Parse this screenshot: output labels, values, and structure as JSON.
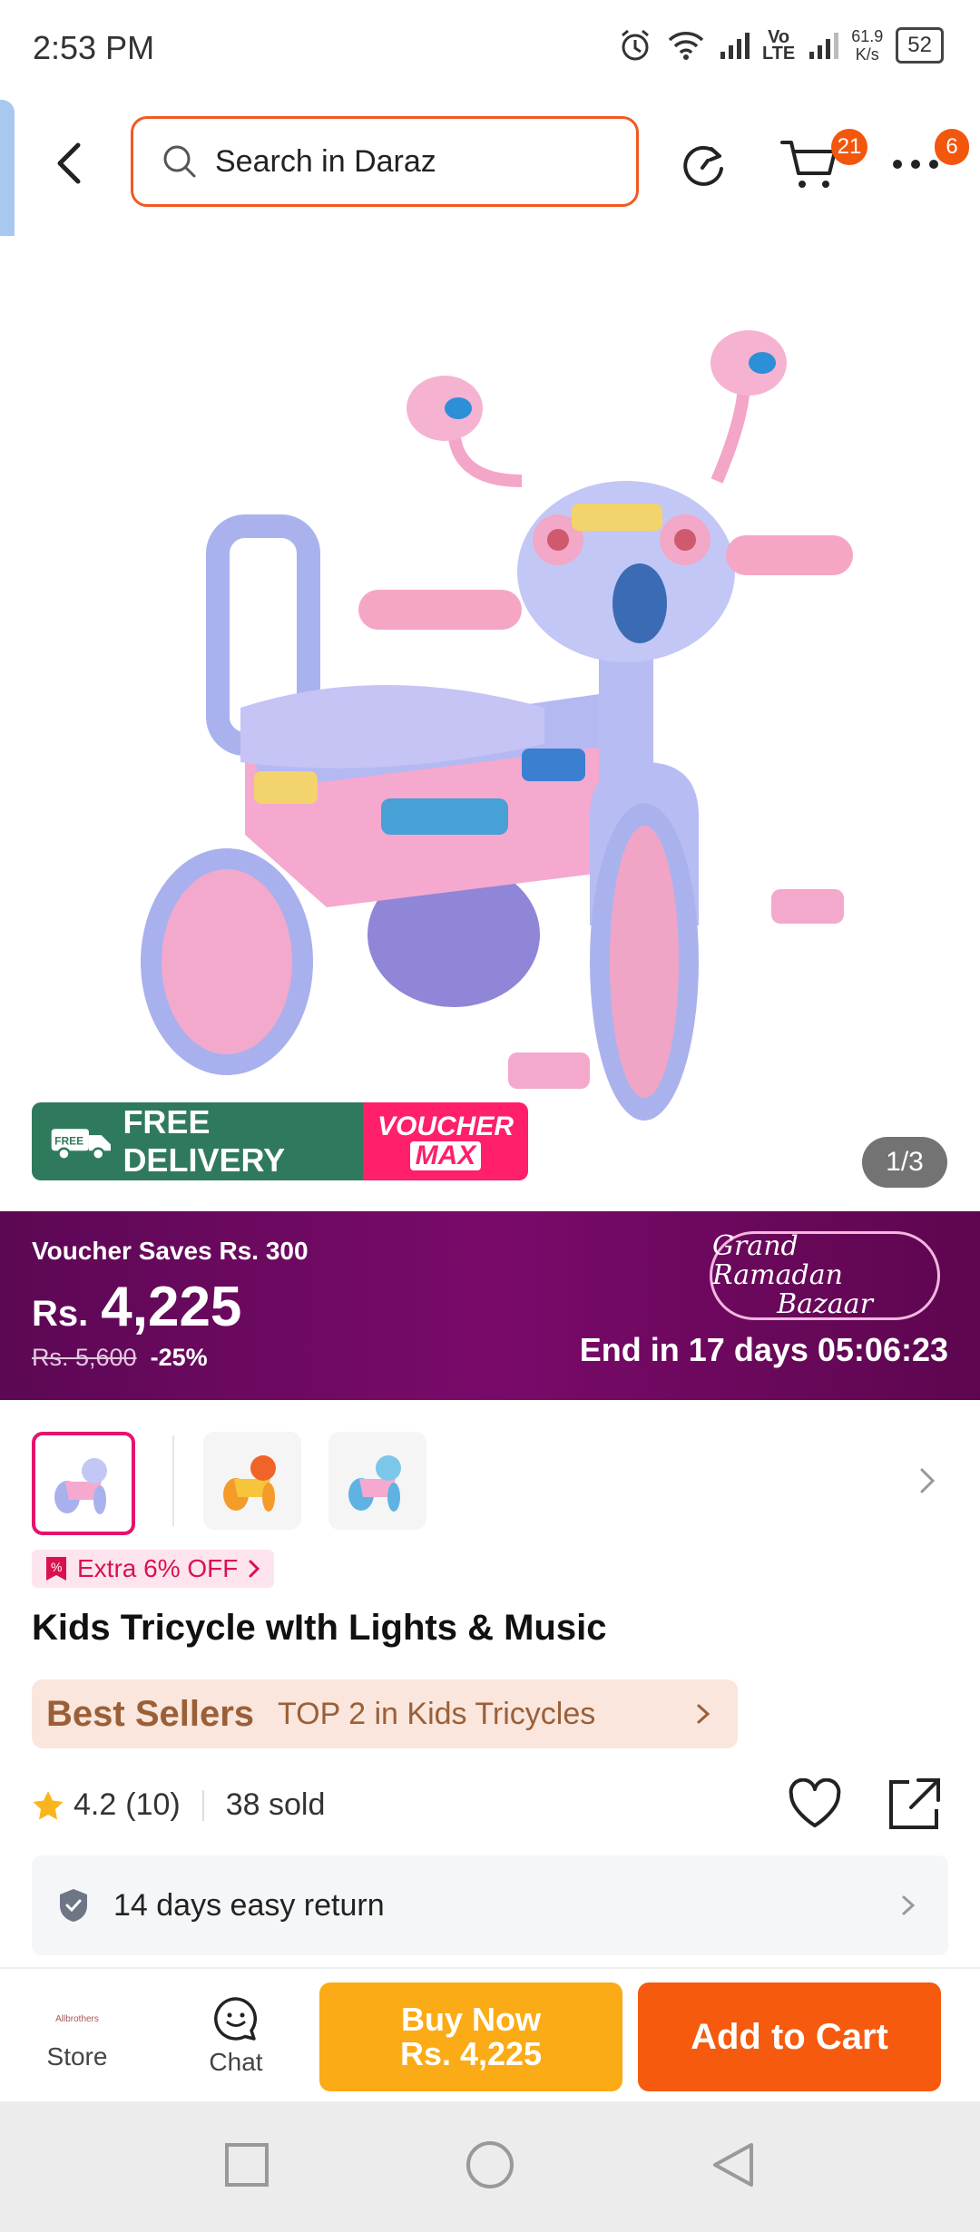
{
  "status_bar": {
    "time": "2:53 PM",
    "net_speed": "61.9",
    "net_unit": "K/s",
    "battery": "52",
    "volte": "Vo",
    "volte2": "LTE"
  },
  "header": {
    "search_placeholder": "Search in Daraz",
    "cart_count": "21",
    "more_count": "6"
  },
  "gallery": {
    "delivery_label": "FREE DELIVERY",
    "free_tag": "FREE",
    "voucher_line1": "VOUCHER",
    "voucher_line2": "MAX",
    "counter": "1/3"
  },
  "promo": {
    "voucher_saves": "Voucher Saves Rs. 300",
    "currency": "Rs.",
    "price": "4,225",
    "old_price": "Rs. 5,600",
    "discount": "-25%",
    "campaign_line1": "Grand Ramadan",
    "campaign_line2": "Bazaar",
    "countdown": "End in 17 days 05:06:23"
  },
  "product": {
    "extra_offer": "Extra 6% OFF",
    "title": "Kids Tricycle wIth Lights & Music",
    "best_sellers_label": "Best Sellers",
    "best_sellers_text": "TOP 2 in Kids Tricycles",
    "rating": "4.2",
    "reviews": "(10)",
    "sold": "38 sold",
    "return_policy": "14 days easy return"
  },
  "bottom_bar": {
    "store_label": "Store",
    "store_logo_text": "Allbrothers",
    "chat_label": "Chat",
    "buy_now_line1": "Buy Now",
    "buy_now_line2": "Rs. 4,225",
    "add_to_cart": "Add to Cart"
  },
  "colors": {
    "accent": "#f55a0e",
    "buy_now": "#fbab15",
    "promo_bg": "#6b0a5e",
    "delivery_green": "#2f7a5c",
    "voucher_pink": "#ff1f6b"
  }
}
